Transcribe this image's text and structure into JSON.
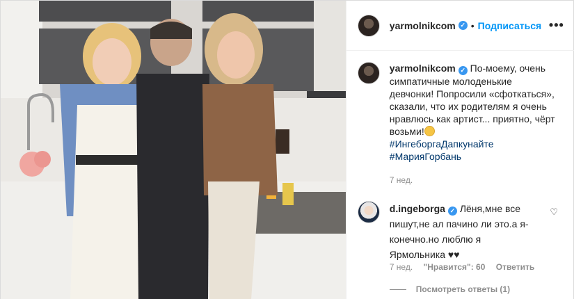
{
  "post": {
    "username": "yarmolnikcom",
    "dot": "•",
    "follow_label": "Подписаться",
    "more_icon": "•••",
    "caption_lines": [
      "По-моему, очень",
      "симпатичные молоденькие",
      "девчонки! Попросили «сфоткаться»,",
      "сказали, что их родителям я очень",
      "нравлюсь как артист... приятно, чёрт",
      "возьми!"
    ],
    "hashtags": [
      "#ИнгеборгаДапкунайте",
      "#МарияГорбань"
    ],
    "timestamp": "7 нед.",
    "verified_icon": "✓"
  },
  "comment": {
    "username": "d.ingeborga",
    "lines": [
      "Лёня,мне все",
      "пишут,не ал пачино ли это.а я-",
      "конечно.но люблю я",
      "Ярмольника ♥♥"
    ],
    "timestamp": "7 нед.",
    "likes_label": "\"Нравится\": 60",
    "reply_label": "Ответить",
    "heart_icon": "♡",
    "view_replies": "Посмотреть ответы (1)"
  },
  "icons": {
    "verified": "verified-badge-icon",
    "heart": "heart-icon",
    "emoji": "smiling-face-icon",
    "more": "more-options-icon"
  },
  "colors": {
    "accent": "#0095f6",
    "verified": "#3897f0",
    "hashtag": "#00376b",
    "muted": "#8e8e8e"
  }
}
